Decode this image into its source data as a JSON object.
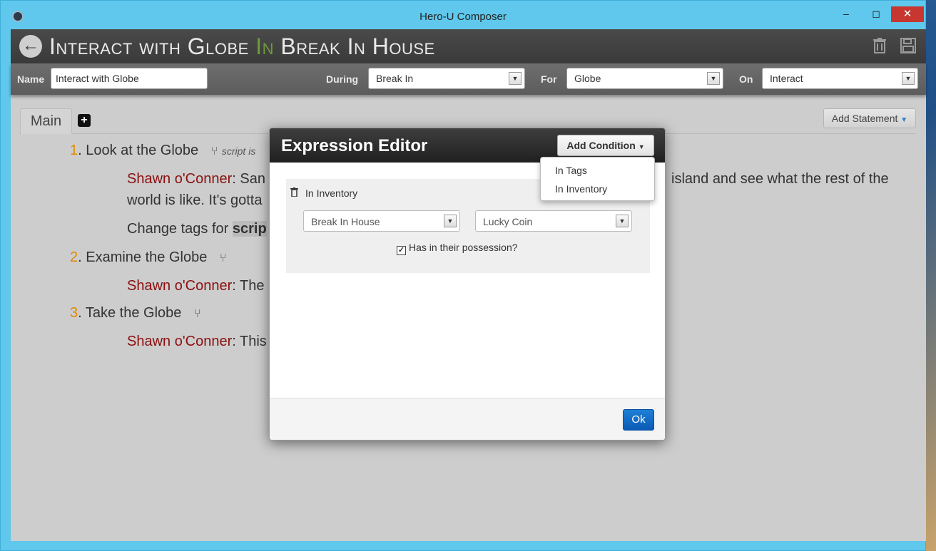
{
  "window": {
    "title": "Hero-U Composer",
    "minimize": "–",
    "maximize": "◻",
    "close": "✕"
  },
  "header": {
    "back_icon": "arrow-left-icon",
    "title_part1": "Interact with Globe",
    "title_in": "In",
    "title_part2": "Break In House",
    "trash_icon": "trash-icon",
    "save_icon": "save-icon"
  },
  "form": {
    "name_label": "Name",
    "name_value": "Interact with Globe",
    "during_label": "During",
    "during_value": "Break In",
    "for_label": "For",
    "for_value": "Globe",
    "on_label": "On",
    "on_value": "Interact"
  },
  "tabs": {
    "main_label": "Main",
    "add_label": "+",
    "add_statement_label": "Add Statement"
  },
  "statements": [
    {
      "number": "1",
      "title": ". Look at the Globe",
      "note": "script is",
      "lines": [
        {
          "speaker": "Shawn o'Conner",
          "text": ": San"
        },
        {
          "text": "world is like. It's gotta"
        },
        {
          "text": "Change tags for ",
          "bold": "scrip"
        }
      ],
      "line_tail": "island and see what the rest of the"
    },
    {
      "number": "2",
      "title": ". Examine the Globe",
      "lines": [
        {
          "speaker": "Shawn o'Conner",
          "text": ": The"
        }
      ]
    },
    {
      "number": "3",
      "title": ". Take the Globe",
      "lines": [
        {
          "speaker": "Shawn o'Conner",
          "text": ": This"
        }
      ]
    }
  ],
  "modal": {
    "title": "Expression Editor",
    "add_condition_label": "Add Condition",
    "dropdown_items": [
      "In Tags",
      "In Inventory"
    ],
    "condition": {
      "label": "In Inventory",
      "location_value": "Break In House",
      "item_value": "Lucky Coin",
      "checkbox_label": "Has in their possession?",
      "checkbox_checked": true
    },
    "ok_label": "Ok"
  },
  "colors": {
    "window_chrome": "#5fc8ec",
    "header_bg": "#3a3a3a",
    "number_accent": "#e08a00",
    "speaker": "#8b0f0f",
    "in_accent": "#6f9a3c",
    "ok_button": "#0b5bb5"
  }
}
